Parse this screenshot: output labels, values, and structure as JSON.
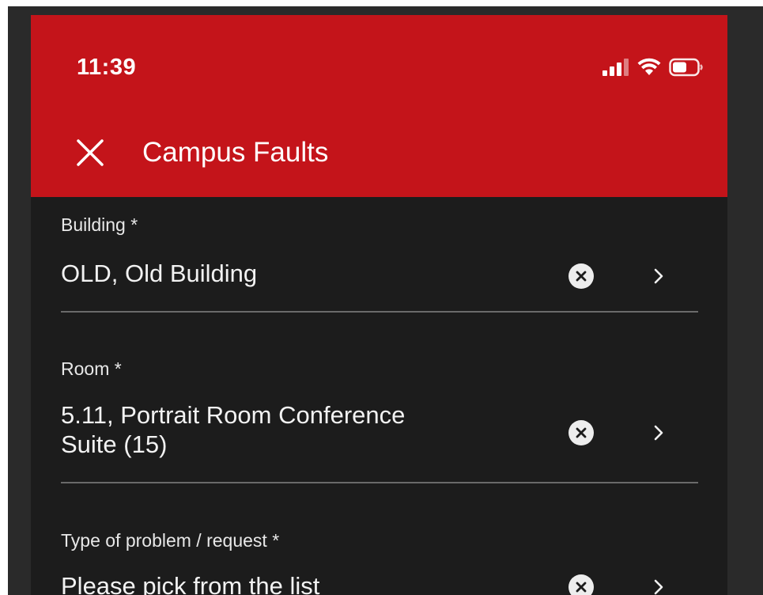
{
  "status_bar": {
    "time": "11:39"
  },
  "header": {
    "title": "Campus Faults",
    "background_color": "#c4141a"
  },
  "form": {
    "building": {
      "label": "Building *",
      "value": "OLD, Old Building"
    },
    "room": {
      "label": "Room *",
      "value_line1": "5.11, Portrait Room Conference",
      "value_line2": "Suite (15)"
    },
    "problem_type": {
      "label": "Type of problem / request *",
      "value": "Please pick from the list"
    }
  },
  "icons": {
    "close": "close-icon",
    "clear": "clear-circle-x-icon",
    "chevron": "chevron-right-icon",
    "signal": "cellular-signal-icon",
    "wifi": "wifi-icon",
    "battery": "battery-icon"
  }
}
